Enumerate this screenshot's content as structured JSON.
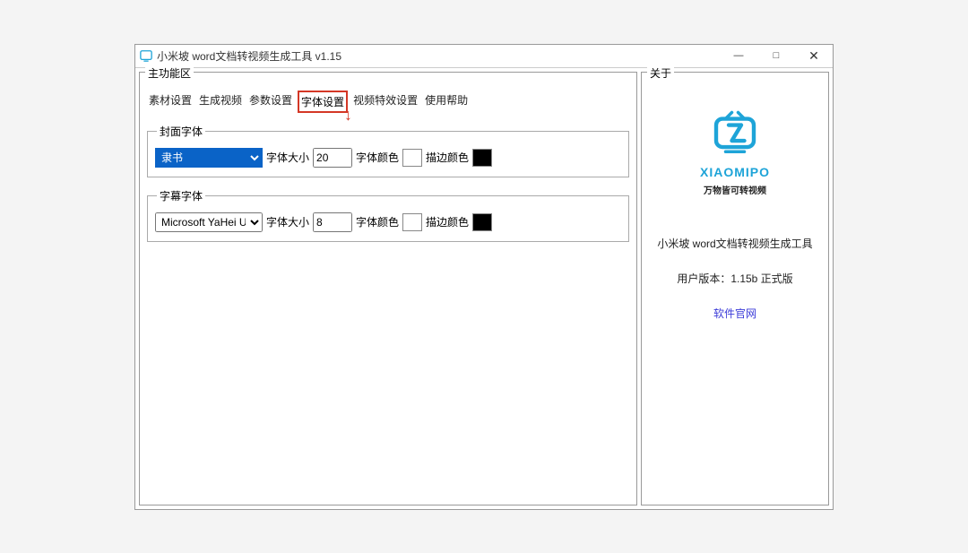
{
  "window": {
    "title": "小米坡 word文档转视频生成工具 v1.15"
  },
  "winbtns": {
    "min": "—",
    "max": "□",
    "close": "✕"
  },
  "main": {
    "legend": "主功能区",
    "tabs": [
      "素材设置",
      "生成视频",
      "参数设置",
      "字体设置",
      "视频特效设置",
      "使用帮助"
    ],
    "cover_font": {
      "legend": "封面字体",
      "font_selected": "隶书",
      "size_label": "字体大小",
      "size_value": "20",
      "color_label": "字体颜色",
      "stroke_label": "描边颜色"
    },
    "subtitle_font": {
      "legend": "字幕字体",
      "font_selected": "Microsoft YaHei UI",
      "size_label": "字体大小",
      "size_value": "8",
      "color_label": "字体颜色",
      "stroke_label": "描边颜色"
    }
  },
  "sidebar": {
    "legend": "关于",
    "brand": "XIAOMIPO",
    "slogan": "万物皆可转视频",
    "line1": "小米坡 word文档转视频生成工具",
    "line2": "用户版本：1.15b 正式版",
    "link": "软件官网"
  }
}
